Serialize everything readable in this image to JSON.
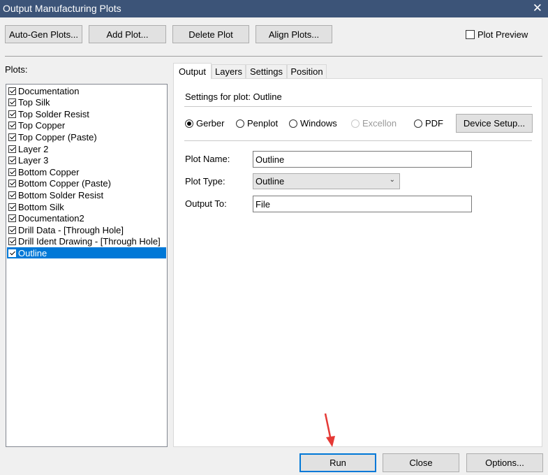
{
  "window": {
    "title": "Output Manufacturing Plots",
    "close_glyph": "✕"
  },
  "toolbar": {
    "auto_gen_label": "Auto-Gen Plots...",
    "add_label": "Add Plot...",
    "delete_label": "Delete Plot",
    "align_label": "Align Plots...",
    "plot_preview_label": "Plot Preview",
    "plot_preview_checked": false
  },
  "plots": {
    "header": "Plots:",
    "items": [
      {
        "label": "Documentation",
        "checked": true
      },
      {
        "label": "Top Silk",
        "checked": true
      },
      {
        "label": "Top Solder Resist",
        "checked": true
      },
      {
        "label": "Top Copper",
        "checked": true
      },
      {
        "label": "Top Copper (Paste)",
        "checked": true
      },
      {
        "label": "Layer 2",
        "checked": true
      },
      {
        "label": "Layer 3",
        "checked": true
      },
      {
        "label": "Bottom Copper",
        "checked": true
      },
      {
        "label": "Bottom Copper (Paste)",
        "checked": true
      },
      {
        "label": "Bottom Solder Resist",
        "checked": true
      },
      {
        "label": "Bottom Silk",
        "checked": true
      },
      {
        "label": "Documentation2",
        "checked": true
      },
      {
        "label": "Drill Data - [Through Hole]",
        "checked": true
      },
      {
        "label": "Drill Ident Drawing - [Through Hole]",
        "checked": true
      },
      {
        "label": "Outline",
        "checked": true,
        "selected": true
      }
    ]
  },
  "tabs": [
    {
      "label": "Output",
      "active": true
    },
    {
      "label": "Layers",
      "active": false
    },
    {
      "label": "Settings",
      "active": false
    },
    {
      "label": "Position",
      "active": false
    }
  ],
  "output": {
    "settings_heading": "Settings for plot: Outline",
    "formats": [
      {
        "label": "Gerber",
        "checked": true,
        "disabled": false
      },
      {
        "label": "Penplot",
        "checked": false,
        "disabled": false
      },
      {
        "label": "Windows",
        "checked": false,
        "disabled": false
      },
      {
        "label": "Excellon",
        "checked": false,
        "disabled": true
      },
      {
        "label": "PDF",
        "checked": false,
        "disabled": false
      }
    ],
    "device_setup_label": "Device Setup...",
    "plot_name_label": "Plot Name:",
    "plot_name_value": "Outline",
    "plot_type_label": "Plot Type:",
    "plot_type_value": "Outline",
    "output_to_label": "Output To:",
    "output_to_value": "File"
  },
  "footer": {
    "run_label": "Run",
    "close_label": "Close",
    "options_label": "Options..."
  },
  "annotation": {
    "arrow_color": "#e53935"
  }
}
